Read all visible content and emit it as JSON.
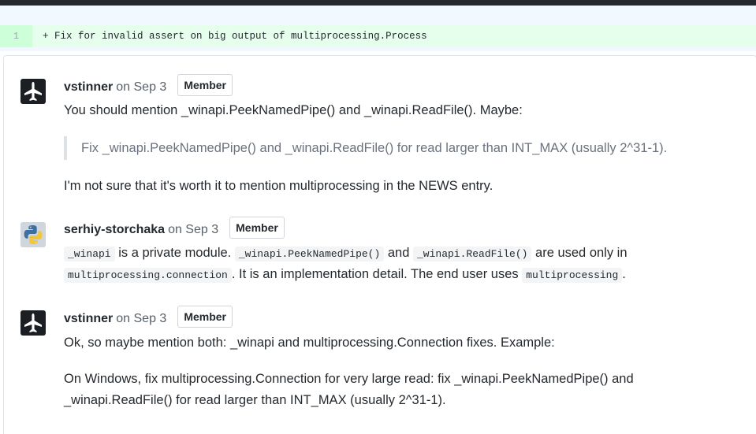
{
  "diff": {
    "line_number": "1",
    "line_text": "+ Fix for invalid assert on big output of multiprocessing.Process"
  },
  "comments": [
    {
      "author": "vstinner",
      "date": "on Sep 3",
      "badge": "Member",
      "avatar_icon": "airplane-icon",
      "text1": "You should mention _winapi.PeekNamedPipe() and _winapi.ReadFile(). Maybe:",
      "quote": "Fix _winapi.PeekNamedPipe() and _winapi.ReadFile() for read larger than INT_MAX (usually 2^31-1).",
      "text2": "I'm not sure that it's worth it to mention multiprocessing in the NEWS entry."
    },
    {
      "author": "serhiy-storchaka",
      "date": "on Sep 3",
      "badge": "Member",
      "avatar_icon": "python-logo-icon",
      "code1": "_winapi",
      "text_a": " is a private module. ",
      "code2": "_winapi.PeekNamedPipe()",
      "text_b": " and ",
      "code3": "_winapi.ReadFile()",
      "text_c": " are used only in",
      "code4": "multiprocessing.connection",
      "text_d": ". It is an implementation detail. The end user uses ",
      "code5": "multiprocessing",
      "text_e": "."
    },
    {
      "author": "vstinner",
      "date": "on Sep 3",
      "badge": "Member",
      "avatar_icon": "airplane-icon",
      "text1": "Ok, so maybe mention both: _winapi and multiprocessing.Connection fixes. Example:",
      "text2_line1": "On Windows, fix multiprocessing.Connection for very large read: fix _winapi.PeekNamedPipe() and",
      "text2_line2": "_winapi.ReadFile() for read larger than INT_MAX (usually 2^31-1)."
    }
  ]
}
